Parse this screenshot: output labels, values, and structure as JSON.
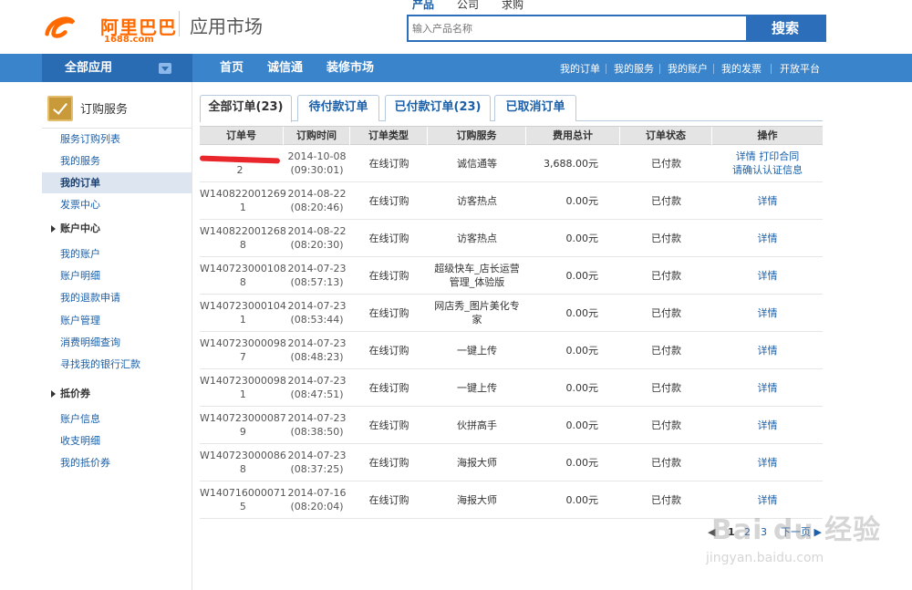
{
  "header": {
    "logo_text": "阿里巴巴",
    "logo_sub": "1688.com",
    "site_name": "应用市场",
    "search_tabs": [
      "产品",
      "公司",
      "求购"
    ],
    "search_placeholder": "输入产品名称",
    "search_button": "搜索"
  },
  "nav": {
    "all_apps": "全部应用",
    "main": [
      "首页",
      "诚信通",
      "装修市场"
    ],
    "right": [
      "我的订单",
      "我的服务",
      "我的账户",
      "我的发票",
      "开放平台"
    ]
  },
  "sidebar": {
    "title": "订购服务",
    "links_top": [
      "服务订购列表",
      "我的服务",
      "我的订单",
      "发票中心"
    ],
    "active_link": "我的订单",
    "group_account": "账户中心",
    "links_account": [
      "我的账户",
      "账户明细",
      "我的退款申请",
      "账户管理",
      "消费明细查询",
      "寻找我的银行汇款"
    ],
    "group_voucher": "抵价券",
    "links_voucher": [
      "账户信息",
      "收支明细",
      "我的抵价券"
    ]
  },
  "tabs": [
    {
      "label": "全部订单(23)",
      "active": true
    },
    {
      "label": "待付款订单",
      "active": false
    },
    {
      "label": "已付款订单(23)",
      "active": false
    },
    {
      "label": "已取消订单",
      "active": false
    }
  ],
  "table": {
    "headers": [
      "订单号",
      "订购时间",
      "订单类型",
      "订购服务",
      "费用总计",
      "订单状态",
      "操作"
    ],
    "rows": [
      {
        "order_l1": "",
        "order_l2": "2",
        "date": "2014-10-08",
        "time": "(09:30:01)",
        "type": "在线订购",
        "service": "诚信通等",
        "fee": "3,688.00元",
        "status": "已付款",
        "ops": [
          "详情",
          "打印合同",
          "请确认认证信息"
        ]
      },
      {
        "order_l1": "W140822001269",
        "order_l2": "1",
        "date": "2014-08-22",
        "time": "(08:20:46)",
        "type": "在线订购",
        "service": "访客热点",
        "fee": "0.00元",
        "status": "已付款",
        "ops": [
          "详情"
        ]
      },
      {
        "order_l1": "W140822001268",
        "order_l2": "8",
        "date": "2014-08-22",
        "time": "(08:20:30)",
        "type": "在线订购",
        "service": "访客热点",
        "fee": "0.00元",
        "status": "已付款",
        "ops": [
          "详情"
        ]
      },
      {
        "order_l1": "W140723000108",
        "order_l2": "8",
        "date": "2014-07-23",
        "time": "(08:57:13)",
        "type": "在线订购",
        "service": "超级快车_店长运营管理_体验版",
        "fee": "0.00元",
        "status": "已付款",
        "ops": [
          "详情"
        ]
      },
      {
        "order_l1": "W140723000104",
        "order_l2": "1",
        "date": "2014-07-23",
        "time": "(08:53:44)",
        "type": "在线订购",
        "service": "网店秀_图片美化专家",
        "fee": "0.00元",
        "status": "已付款",
        "ops": [
          "详情"
        ]
      },
      {
        "order_l1": "W140723000098",
        "order_l2": "7",
        "date": "2014-07-23",
        "time": "(08:48:23)",
        "type": "在线订购",
        "service": "一键上传",
        "fee": "0.00元",
        "status": "已付款",
        "ops": [
          "详情"
        ]
      },
      {
        "order_l1": "W140723000098",
        "order_l2": "1",
        "date": "2014-07-23",
        "time": "(08:47:51)",
        "type": "在线订购",
        "service": "一键上传",
        "fee": "0.00元",
        "status": "已付款",
        "ops": [
          "详情"
        ]
      },
      {
        "order_l1": "W140723000087",
        "order_l2": "9",
        "date": "2014-07-23",
        "time": "(08:38:50)",
        "type": "在线订购",
        "service": "伙拼高手",
        "fee": "0.00元",
        "status": "已付款",
        "ops": [
          "详情"
        ]
      },
      {
        "order_l1": "W140723000086",
        "order_l2": "8",
        "date": "2014-07-23",
        "time": "(08:37:25)",
        "type": "在线订购",
        "service": "海报大师",
        "fee": "0.00元",
        "status": "已付款",
        "ops": [
          "详情"
        ]
      },
      {
        "order_l1": "W140716000071",
        "order_l2": "5",
        "date": "2014-07-16",
        "time": "(08:20:04)",
        "type": "在线订购",
        "service": "海报大师",
        "fee": "0.00元",
        "status": "已付款",
        "ops": [
          "详情"
        ]
      }
    ]
  },
  "pager": {
    "prev": "◀",
    "pages": [
      "1",
      "2",
      "3"
    ],
    "current": "1",
    "next": "下一页 ▶"
  },
  "watermark": {
    "text": "Bai du 经验",
    "url": "jingyan.baidu.com"
  },
  "colors": {
    "nav_blue": "#3a84cc",
    "nav_dark": "#2a6cb3",
    "link_blue": "#1a5fa8",
    "brand_orange": "#ff6a00"
  }
}
